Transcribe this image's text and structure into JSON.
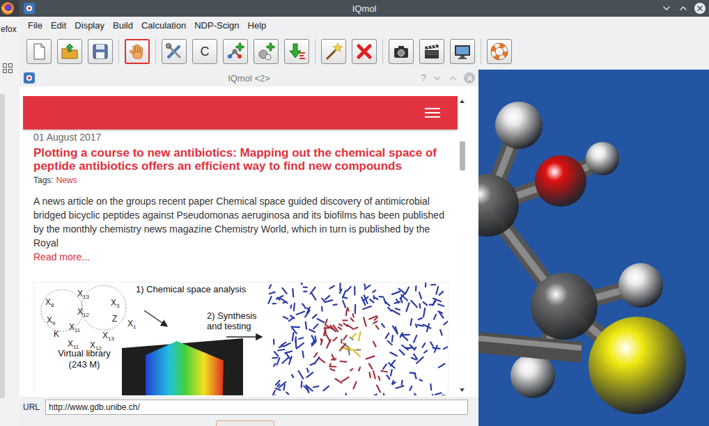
{
  "desktop": {
    "peek_text": "efox"
  },
  "window": {
    "title": "IQmol"
  },
  "menu": [
    "File",
    "Edit",
    "Display",
    "Build",
    "Calculation",
    "NDP-Scign",
    "Help"
  ],
  "toolbar": [
    [
      {
        "kind": "new",
        "selected": false
      },
      {
        "kind": "open",
        "selected": false
      },
      {
        "kind": "save",
        "selected": false
      }
    ],
    [
      {
        "kind": "select",
        "selected": true
      }
    ],
    [
      {
        "kind": "build",
        "selected": false
      },
      {
        "kind": "element",
        "label": "C",
        "selected": false
      },
      {
        "kind": "add-atom",
        "selected": false
      },
      {
        "kind": "add-fragment",
        "selected": false
      },
      {
        "kind": "minimize",
        "selected": false
      }
    ],
    [
      {
        "kind": "symmetrize",
        "selected": false
      },
      {
        "kind": "delete",
        "selected": false
      }
    ],
    [
      {
        "kind": "snapshot",
        "selected": false
      },
      {
        "kind": "record",
        "selected": false
      },
      {
        "kind": "fullscreen",
        "selected": false
      }
    ],
    [
      {
        "kind": "help",
        "selected": false
      }
    ]
  ],
  "help_window": {
    "title": "IQmol <2>",
    "help_glyph": "?",
    "scrollbar": {
      "level": 0.13
    }
  },
  "article": {
    "date": "01 August 2017",
    "title": "Plotting a course to new antibiotics: Mapping out the chemical space of peptide antibiotics offers an efficient way to find new compounds",
    "tags_label": "Tags:",
    "tag": "News",
    "body": "A news article on the groups recent paper Chemical space guided discovery of antimicrobial bridged bicyclic peptides against Pseudomonas aeruginosa and its biofilms has been published by the monthly chemistry news magazine Chemistry World, which in turn is published by the Royal",
    "more": "Read more..."
  },
  "figure": {
    "step1": "1) Chemical space analysis",
    "step2": [
      "2) Synthesis",
      "and testing"
    ],
    "library": [
      "Virtual library",
      "(243 M)"
    ],
    "ring": [
      {
        "base": "X",
        "sub": "13"
      },
      {
        "base": "X",
        "sub": "8"
      },
      {
        "base": "X",
        "sub": "12"
      },
      {
        "base": "X",
        "sub": "3"
      },
      {
        "base": "X",
        "sub": "9"
      },
      {
        "base": "Z",
        "sub": ""
      },
      {
        "base": "X",
        "sub": "1"
      },
      {
        "base": "X",
        "sub": "11"
      },
      {
        "base": "K",
        "sub": ""
      },
      {
        "base": "X",
        "sub": "13"
      },
      {
        "base": "X",
        "sub": "11"
      },
      {
        "base": "X",
        "sub": "12"
      }
    ]
  },
  "url": {
    "label": "URL",
    "value": "http://www.gdb.unibe.ch/"
  }
}
